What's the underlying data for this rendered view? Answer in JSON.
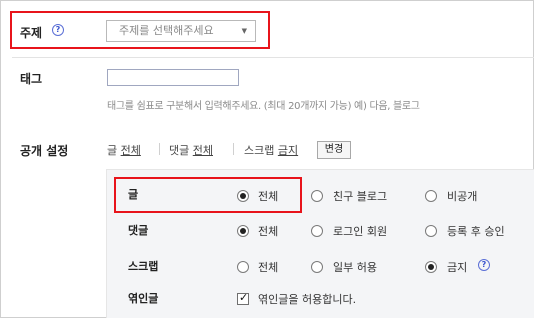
{
  "topic": {
    "label": "주제",
    "help": "?",
    "select_value": "주제를 선택해주세요"
  },
  "tag": {
    "label": "태그",
    "input_value": "",
    "hint": "태그를 쉼표로 구분해서 입력해주세요. (최대 20개까지 가능) 예) 다음, 블로그"
  },
  "visibility": {
    "label": "공개 설정",
    "summary": [
      {
        "name": "글",
        "value": "전체"
      },
      {
        "name": "댓글",
        "value": "전체"
      },
      {
        "name": "스크랩",
        "value": "금지"
      }
    ],
    "change_button": "변경",
    "rows": [
      {
        "label": "글",
        "options": [
          {
            "text": "전체",
            "selected": true
          },
          {
            "text": "친구 블로그",
            "selected": false
          },
          {
            "text": "비공개",
            "selected": false
          }
        ]
      },
      {
        "label": "댓글",
        "options": [
          {
            "text": "전체",
            "selected": true
          },
          {
            "text": "로그인 회원",
            "selected": false
          },
          {
            "text": "등록 후 승인",
            "selected": false
          }
        ]
      },
      {
        "label": "스크랩",
        "options": [
          {
            "text": "전체",
            "selected": false
          },
          {
            "text": "일부 허용",
            "selected": false
          },
          {
            "text": "금지",
            "selected": true
          }
        ],
        "help": "?"
      }
    ],
    "trackback": {
      "label": "엮인글",
      "checkbox_label": "엮인글을 허용합니다.",
      "checked": true
    }
  },
  "colors": {
    "highlight": "#e8141b",
    "help_icon": "#3b55cf",
    "panel_bg": "#f4f5f7"
  }
}
